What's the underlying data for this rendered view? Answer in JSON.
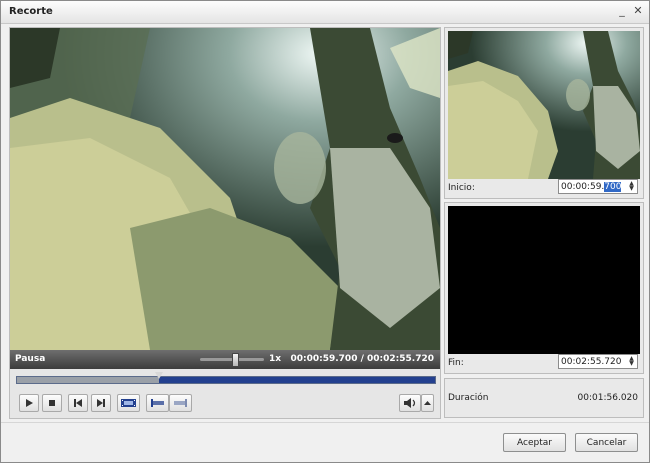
{
  "window": {
    "title": "Recorte"
  },
  "player": {
    "status": "Pausa",
    "speed": "1x",
    "speed_level": 0.55,
    "time_display": "00:00:59.700 / 00:02:55.720",
    "progress_fraction": 0.34
  },
  "start": {
    "label": "Inicio:",
    "value_prefix": "00:00:59.",
    "value_selected": "700"
  },
  "end": {
    "label": "Fin:",
    "value": "00:02:55.720"
  },
  "duration": {
    "label": "Duración",
    "value": "00:01:56.020"
  },
  "buttons": {
    "ok": "Aceptar",
    "cancel": "Cancelar"
  },
  "icons": [
    "play-icon",
    "stop-icon",
    "previous-frame-icon",
    "next-frame-icon",
    "filmstrip-icon",
    "set-start-icon",
    "set-end-icon",
    "volume-icon",
    "dropdown-arrow-icon",
    "minimize-icon",
    "close-icon"
  ],
  "colors": {
    "timeline": "#23408f",
    "status_bar": "#4a4a4a",
    "selection": "#3169c6"
  }
}
